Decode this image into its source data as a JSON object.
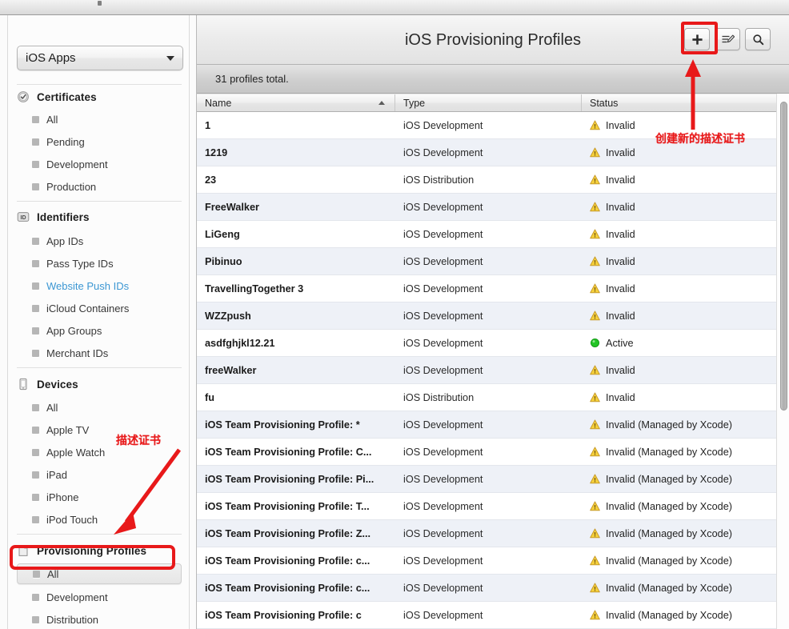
{
  "window": {
    "chrome_strip": true
  },
  "sidebar": {
    "selector": {
      "value": "iOS Apps",
      "icon": "chevron-down-icon"
    },
    "groups": [
      {
        "title": "Certificates",
        "icon": "certificate-seal-icon",
        "items": [
          {
            "label": "All",
            "state": "normal"
          },
          {
            "label": "Pending",
            "state": "normal"
          },
          {
            "label": "Development",
            "state": "normal"
          },
          {
            "label": "Production",
            "state": "normal"
          }
        ]
      },
      {
        "title": "Identifiers",
        "icon": "id-badge-icon",
        "items": [
          {
            "label": "App IDs",
            "state": "normal"
          },
          {
            "label": "Pass Type IDs",
            "state": "normal"
          },
          {
            "label": "Website Push IDs",
            "state": "link"
          },
          {
            "label": "iCloud Containers",
            "state": "normal"
          },
          {
            "label": "App Groups",
            "state": "normal"
          },
          {
            "label": "Merchant IDs",
            "state": "normal"
          }
        ]
      },
      {
        "title": "Devices",
        "icon": "device-phone-icon",
        "items": [
          {
            "label": "All",
            "state": "normal"
          },
          {
            "label": "Apple TV",
            "state": "normal"
          },
          {
            "label": "Apple Watch",
            "state": "normal"
          },
          {
            "label": "iPad",
            "state": "normal"
          },
          {
            "label": "iPhone",
            "state": "normal"
          },
          {
            "label": "iPod Touch",
            "state": "normal"
          }
        ]
      },
      {
        "title": "Provisioning Profiles",
        "icon": "document-profile-icon",
        "items": [
          {
            "label": "All",
            "state": "selected"
          },
          {
            "label": "Development",
            "state": "normal"
          },
          {
            "label": "Distribution",
            "state": "normal"
          }
        ]
      }
    ]
  },
  "header": {
    "title": "iOS Provisioning Profiles",
    "buttons": [
      {
        "name": "add-button",
        "icon": "plus-icon",
        "label": "+"
      },
      {
        "name": "edit-button",
        "icon": "edit-list-icon",
        "label": ""
      },
      {
        "name": "search-button",
        "icon": "search-icon",
        "label": ""
      }
    ]
  },
  "summary": {
    "text": "31 profiles total."
  },
  "table": {
    "columns": [
      {
        "key": "name",
        "label": "Name",
        "sorted": "asc"
      },
      {
        "key": "type",
        "label": "Type",
        "sorted": ""
      },
      {
        "key": "status",
        "label": "Status",
        "sorted": ""
      }
    ],
    "rows": [
      {
        "name": "1",
        "type": "iOS Development",
        "status": "Invalid",
        "status_icon": "warning-icon"
      },
      {
        "name": "1219",
        "type": "iOS Development",
        "status": "Invalid",
        "status_icon": "warning-icon"
      },
      {
        "name": "23",
        "type": "iOS Distribution",
        "status": "Invalid",
        "status_icon": "warning-icon"
      },
      {
        "name": "FreeWalker",
        "type": "iOS Development",
        "status": "Invalid",
        "status_icon": "warning-icon"
      },
      {
        "name": "LiGeng",
        "type": "iOS Development",
        "status": "Invalid",
        "status_icon": "warning-icon"
      },
      {
        "name": "Pibinuo",
        "type": "iOS Development",
        "status": "Invalid",
        "status_icon": "warning-icon"
      },
      {
        "name": "TravellingTogether 3",
        "type": "iOS Development",
        "status": "Invalid",
        "status_icon": "warning-icon"
      },
      {
        "name": "WZZpush",
        "type": "iOS Development",
        "status": "Invalid",
        "status_icon": "warning-icon"
      },
      {
        "name": "asdfghjkl12.21",
        "type": "iOS Development",
        "status": "Active",
        "status_icon": "active-dot-icon"
      },
      {
        "name": "freeWalker",
        "type": "iOS Development",
        "status": "Invalid",
        "status_icon": "warning-icon"
      },
      {
        "name": "fu",
        "type": "iOS Distribution",
        "status": "Invalid",
        "status_icon": "warning-icon"
      },
      {
        "name": "iOS Team Provisioning Profile: *",
        "type": "iOS Development",
        "status": "Invalid (Managed by Xcode)",
        "status_icon": "warning-icon"
      },
      {
        "name": "iOS Team Provisioning Profile: C...",
        "type": "iOS Development",
        "status": "Invalid (Managed by Xcode)",
        "status_icon": "warning-icon"
      },
      {
        "name": "iOS Team Provisioning Profile: Pi...",
        "type": "iOS Development",
        "status": "Invalid (Managed by Xcode)",
        "status_icon": "warning-icon"
      },
      {
        "name": "iOS Team Provisioning Profile: T...",
        "type": "iOS Development",
        "status": "Invalid (Managed by Xcode)",
        "status_icon": "warning-icon"
      },
      {
        "name": "iOS Team Provisioning Profile: Z...",
        "type": "iOS Development",
        "status": "Invalid (Managed by Xcode)",
        "status_icon": "warning-icon"
      },
      {
        "name": "iOS Team Provisioning Profile: c...",
        "type": "iOS Development",
        "status": "Invalid (Managed by Xcode)",
        "status_icon": "warning-icon"
      },
      {
        "name": "iOS Team Provisioning Profile: c...",
        "type": "iOS Development",
        "status": "Invalid (Managed by Xcode)",
        "status_icon": "warning-icon"
      },
      {
        "name": "iOS Team Provisioning Profile: c",
        "type": "iOS Development",
        "status": "Invalid (Managed by Xcode)",
        "status_icon": "warning-icon"
      }
    ]
  },
  "annotations": {
    "color": "#e8191a",
    "create_label": "创建新的描述证书",
    "profile_label": "描述证书"
  },
  "colors": {
    "accent_red": "#e8191a",
    "link_blue": "#3c97d3",
    "warning_yellow": "#f4c21b",
    "active_green": "#1db421",
    "row_stripe": "#eef1f7"
  }
}
